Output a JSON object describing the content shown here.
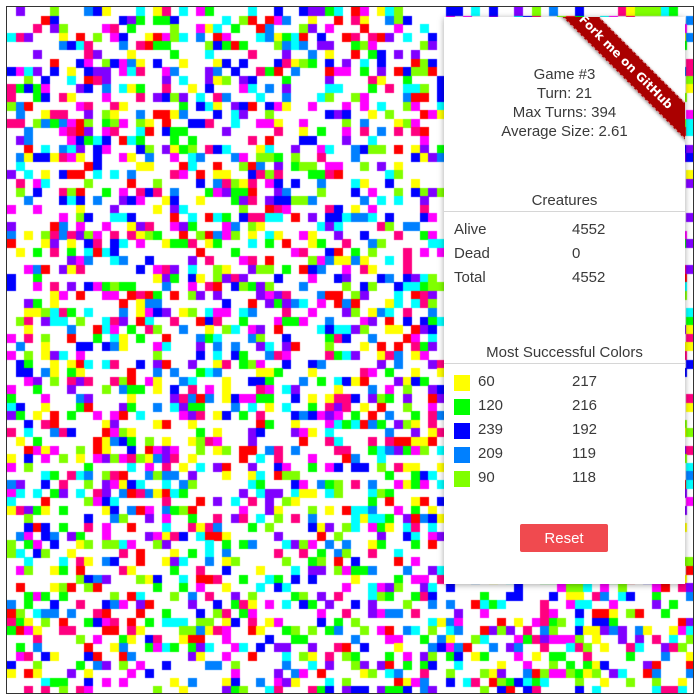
{
  "board": {
    "palette": [
      "#ff0000",
      "#ff00ff",
      "#ffff00",
      "#00ff00",
      "#00ffff",
      "#0000ff",
      "#8000ff",
      "#0080ff",
      "#80ff00",
      "#ff0080"
    ],
    "border_color": "#333333"
  },
  "ribbon": {
    "label": "Fork me on GitHub",
    "color": "#aa0000"
  },
  "stats": {
    "game": "Game #3",
    "turn": "Turn: 21",
    "max_turns": "Max Turns: 394",
    "average_size": "Average Size: 2.61"
  },
  "creatures": {
    "title": "Creatures",
    "rows": [
      {
        "label": "Alive",
        "value": "4552"
      },
      {
        "label": "Dead",
        "value": "0"
      },
      {
        "label": "Total",
        "value": "4552"
      }
    ]
  },
  "colors": {
    "title": "Most Successful Colors",
    "rows": [
      {
        "color": "#ffff00",
        "hue": "60",
        "count": "217"
      },
      {
        "color": "#00ff00",
        "hue": "120",
        "count": "216"
      },
      {
        "color": "#0000ff",
        "hue": "239",
        "count": "192"
      },
      {
        "color": "#0080ff",
        "hue": "209",
        "count": "119"
      },
      {
        "color": "#80ff00",
        "hue": "90",
        "count": "118"
      }
    ]
  },
  "reset": {
    "label": "Reset",
    "color": "#f04a4f"
  }
}
